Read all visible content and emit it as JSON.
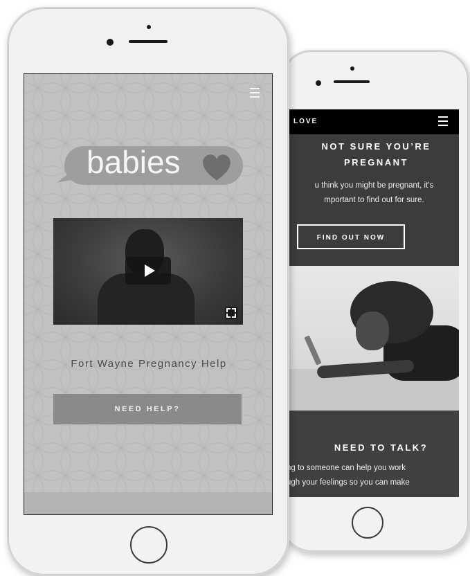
{
  "back_phone": {
    "brand": "LOVE",
    "heading_line1": "NOT SURE YOU’RE",
    "heading_line2": "PREGNANT",
    "text_line1": "u think you might be pregnant, it’s",
    "text_line2": "mportant to find out for sure.",
    "cta_label": "FIND OUT NOW",
    "talk_heading": "NEED TO TALK?",
    "talk_line1": "ng to someone can help you work",
    "talk_line2": "ugh your feelings so you can make"
  },
  "front_phone": {
    "logo_text": "babies",
    "tagline": "Fort Wayne Pregnancy Help",
    "cta_label": "NEED HELP?"
  },
  "icons": [
    "hamburger-menu-icon",
    "heart-icon",
    "play-icon",
    "fullscreen-icon"
  ],
  "colors": {
    "front_background": "#c2c2c2",
    "logo_bubble": "#9e9e9e",
    "need_help_button": "#8a8a8a",
    "back_header": "#000000",
    "back_content": "#3c3c3c"
  }
}
